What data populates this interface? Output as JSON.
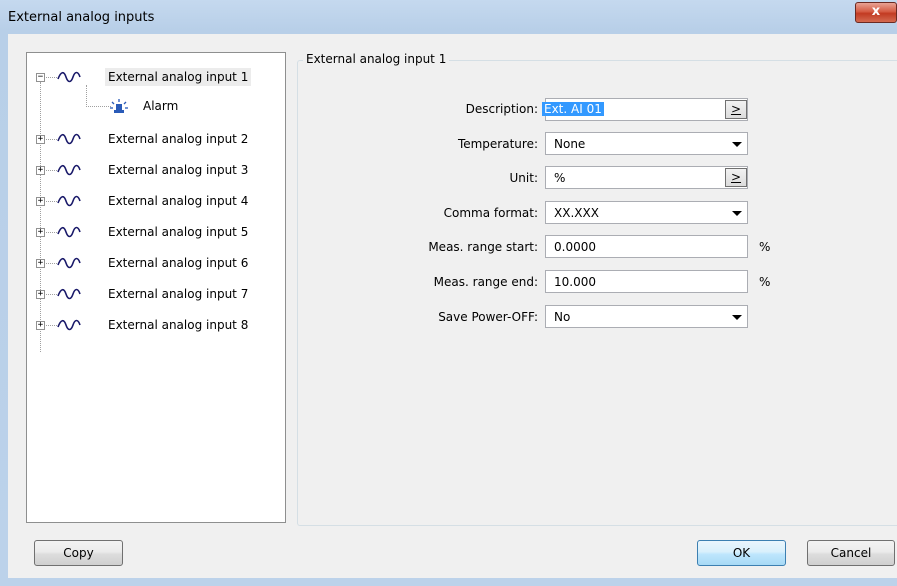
{
  "window": {
    "title": "External analog inputs",
    "close_label": "x"
  },
  "tree": {
    "items": [
      {
        "label": "External analog input 1",
        "expanded": true,
        "selected": true,
        "children": [
          {
            "label": "Alarm",
            "icon": "alarm-icon"
          }
        ]
      },
      {
        "label": "External analog input 2"
      },
      {
        "label": "External analog input 3"
      },
      {
        "label": "External analog input 4"
      },
      {
        "label": "External analog input 5"
      },
      {
        "label": "External analog input 6"
      },
      {
        "label": "External analog input 7"
      },
      {
        "label": "External analog input 8"
      }
    ],
    "item_icon": "analog-wave-icon"
  },
  "group": {
    "title": "External analog input 1"
  },
  "form": {
    "description": {
      "label": "Description:",
      "value": "Ext. AI 01",
      "button": ">"
    },
    "temperature": {
      "label": "Temperature:",
      "value": "None"
    },
    "unit": {
      "label": "Unit:",
      "value": "%",
      "button": ">"
    },
    "comma_format": {
      "label": "Comma format:",
      "value": "XX.XXX"
    },
    "range_start": {
      "label": "Meas. range start:",
      "value": "0.0000",
      "unit": "%"
    },
    "range_end": {
      "label": "Meas. range end:",
      "value": "10.000",
      "unit": "%"
    },
    "save_power_off": {
      "label": "Save Power-OFF:",
      "value": "No"
    }
  },
  "buttons": {
    "copy": "Copy",
    "ok": "OK",
    "cancel": "Cancel"
  }
}
